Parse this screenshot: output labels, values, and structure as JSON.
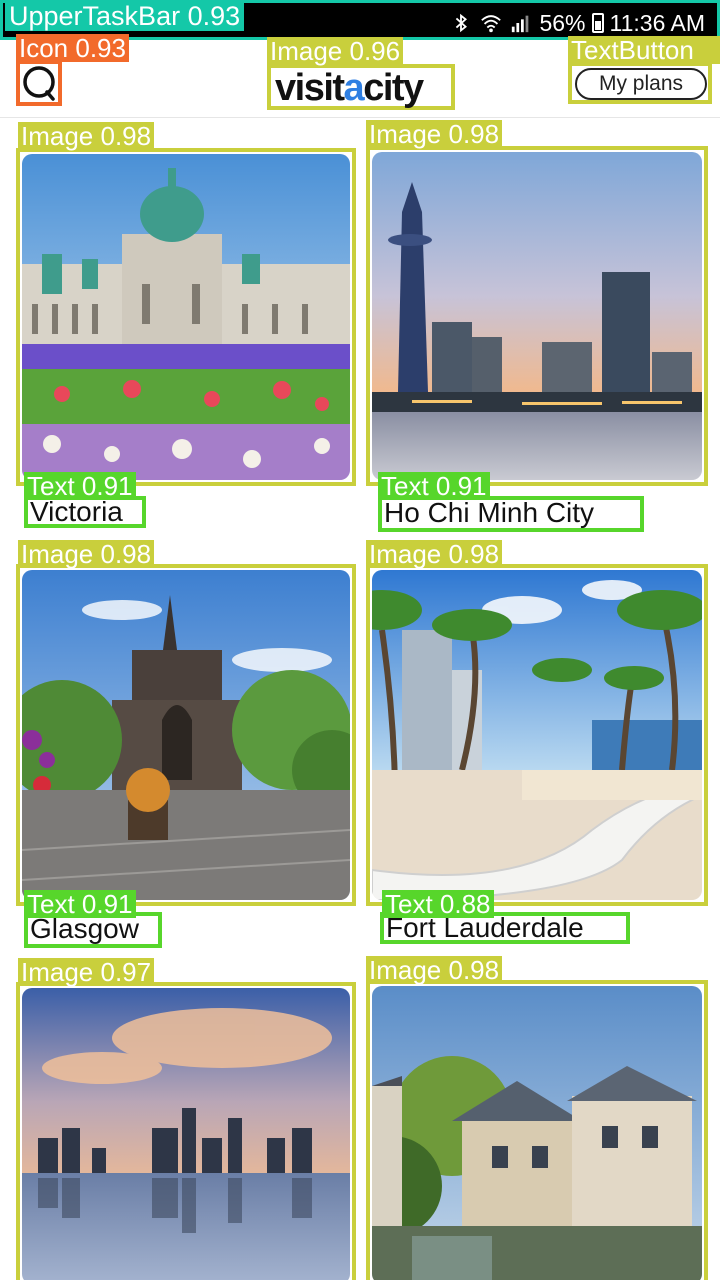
{
  "status_bar": {
    "detection_label": "UpperTaskBar 0.93",
    "battery": "56%",
    "time": "11:36 AM"
  },
  "header": {
    "search_label": "Icon 0.93",
    "logo_label": "Image 0.96",
    "logo_text_1": "visit",
    "logo_text_a": "a",
    "logo_text_2": "city",
    "plans_label": "TextButton",
    "plans_button": "My plans"
  },
  "cards": [
    {
      "image_label": "Image 0.98",
      "text_label": "Text 0.91",
      "name": "Victoria"
    },
    {
      "image_label": "Image 0.98",
      "text_label": "Text 0.91",
      "name": "Ho Chi Minh City"
    },
    {
      "image_label": "Image 0.98",
      "text_label": "Text 0.91",
      "name": "Glasgow"
    },
    {
      "image_label": "Image 0.98",
      "text_label": "Text 0.88",
      "name": "Fort Lauderdale"
    },
    {
      "image_label": "Image 0.97"
    },
    {
      "image_label": "Image 0.98"
    }
  ],
  "colors": {
    "status_bar_frame": "#14c8a8",
    "icon_box": "#f26a2b",
    "image_box": "#c9cf3c",
    "text_box": "#57d62b",
    "logo_accent": "#2f7fe2"
  }
}
